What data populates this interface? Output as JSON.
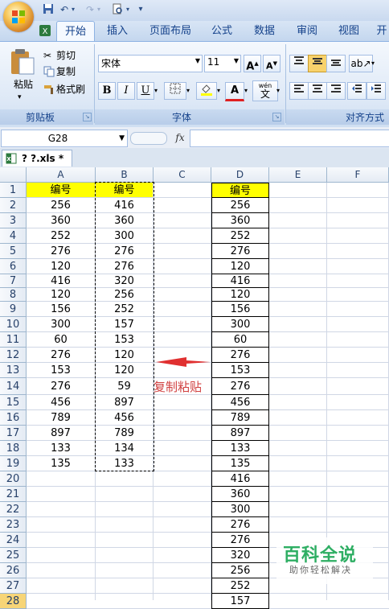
{
  "quick_access": {
    "save_icon": "save-icon",
    "undo_icon": "undo-icon",
    "redo_icon": "redo-icon",
    "preview_icon": "print-preview-icon"
  },
  "tabs": [
    {
      "label": "开始",
      "active": true
    },
    {
      "label": "插入"
    },
    {
      "label": "页面布局"
    },
    {
      "label": "公式"
    },
    {
      "label": "数据"
    },
    {
      "label": "审阅"
    },
    {
      "label": "视图"
    },
    {
      "label": "开"
    }
  ],
  "clipboard": {
    "paste": "粘贴",
    "cut": "剪切",
    "copy": "复制",
    "format_painter": "格式刷",
    "group": "剪贴板"
  },
  "font": {
    "name": "宋体",
    "size": "11",
    "bold": "B",
    "italic": "I",
    "underline": "U",
    "wen": "wén",
    "wen_char": "文",
    "group": "字体",
    "color_a": "A",
    "grow": "A",
    "shrink": "A"
  },
  "alignment": {
    "group": "对齐方式"
  },
  "formula_bar": {
    "name_box": "G28",
    "fx": "fx",
    "formula": ""
  },
  "workbook": {
    "tab_label": "? ?.xls *"
  },
  "columns": [
    "A",
    "B",
    "C",
    "D",
    "E",
    "F"
  ],
  "rows": [
    "1",
    "2",
    "3",
    "4",
    "5",
    "6",
    "7",
    "8",
    "9",
    "10",
    "11",
    "12",
    "13",
    "14",
    "15",
    "16",
    "17",
    "18",
    "19",
    "20",
    "21",
    "22",
    "23",
    "24",
    "25",
    "26",
    "27",
    "28"
  ],
  "col_a": [
    "编号",
    "256",
    "360",
    "252",
    "276",
    "120",
    "416",
    "120",
    "156",
    "300",
    "60",
    "276",
    "153",
    "276",
    "456",
    "789",
    "897",
    "133",
    "135"
  ],
  "col_b": [
    "编号",
    "416",
    "360",
    "300",
    "276",
    "276",
    "320",
    "256",
    "252",
    "157",
    "153",
    "120",
    "120",
    "59",
    "897",
    "456",
    "789",
    "134",
    "133"
  ],
  "col_d": [
    "编号",
    "256",
    "360",
    "252",
    "276",
    "120",
    "416",
    "120",
    "156",
    "300",
    "60",
    "276",
    "153",
    "276",
    "456",
    "789",
    "897",
    "133",
    "135",
    "416",
    "360",
    "300",
    "276",
    "276",
    "320",
    "256",
    "252",
    "157"
  ],
  "annotation": {
    "label": "复制粘贴"
  },
  "watermark": {
    "title": "百科全说",
    "subtitle": "助你轻松解决"
  },
  "colors": {
    "header_fill": "#ffff00",
    "arrow": "#e03030"
  }
}
